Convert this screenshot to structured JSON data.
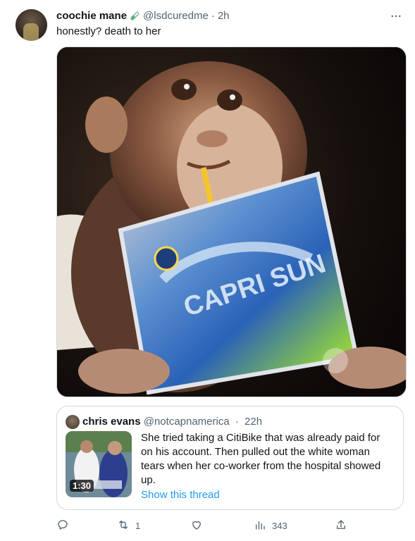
{
  "author": {
    "name": "coochie mane",
    "handle": "@lsdcuredme",
    "separator": "·",
    "time": "2h",
    "avatar": "avatar-photo",
    "name_emoji": "test-tube-emoji"
  },
  "tweet": {
    "text": "honestly? death to her",
    "media_description_icon": "monkey-capri-sun-photo",
    "more_icon": "more-icon"
  },
  "quote": {
    "name": "chris evans",
    "handle": "@notcapnamerica",
    "separator": "·",
    "time": "22h",
    "text": "She tried taking a CitiBike that was already paid for on his account. Then pulled out the white woman tears when her co-worker from the hospital showed up.",
    "duration": "1:30",
    "show_thread": "Show this thread"
  },
  "actions": {
    "reply_count": "",
    "retweet_count": "1",
    "like_count": "",
    "views_count": "343"
  },
  "colors": {
    "accent": "#1d9bf0",
    "secondary_text": "#536471",
    "border": "#cfd9de"
  }
}
